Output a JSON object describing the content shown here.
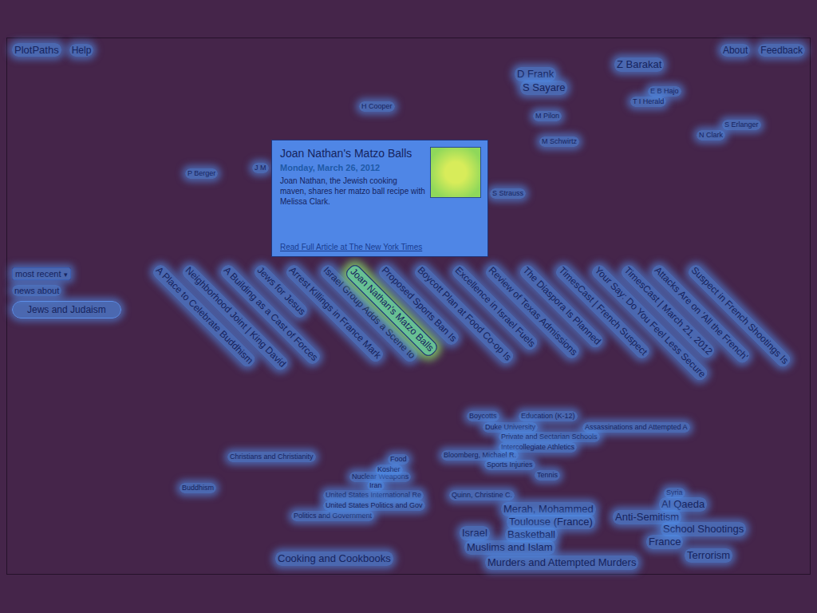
{
  "header": {
    "title": "PlotPaths",
    "links": [
      "Help",
      "About",
      "Feedback"
    ]
  },
  "sidebar": {
    "sort_select": "most recent",
    "label": "news about",
    "topic": "Jews and Judaism"
  },
  "authors": [
    {
      "name": "D Frank",
      "kind": "major"
    },
    {
      "name": "S Sayare",
      "kind": "major"
    },
    {
      "name": "Z Barakat",
      "kind": "major"
    },
    {
      "name": "E B Hajo",
      "kind": "minor"
    },
    {
      "name": "T I Herald",
      "kind": "minor"
    },
    {
      "name": "M Pilon",
      "kind": "minor"
    },
    {
      "name": "S Erlanger",
      "kind": "minor"
    },
    {
      "name": "N Clark",
      "kind": "minor"
    },
    {
      "name": "M Schwirtz",
      "kind": "minor"
    },
    {
      "name": "H Cooper",
      "kind": "minor"
    },
    {
      "name": "P Berger",
      "kind": "minor"
    },
    {
      "name": "J M",
      "kind": "minor"
    },
    {
      "name": "S Strauss",
      "kind": "minor"
    }
  ],
  "articles": [
    {
      "title": "A Place to Celebrate Buddhism",
      "selected": false
    },
    {
      "title": "Neighborhood Joint | King David",
      "selected": false
    },
    {
      "title": "A Building as a Cast of Forces",
      "selected": false
    },
    {
      "title": "Jews for Jesus",
      "selected": false
    },
    {
      "title": "Arrest Killings in France Mark",
      "selected": false
    },
    {
      "title": "Israel Group Adds a Scene to",
      "selected": false
    },
    {
      "title": "Joan Nathan's Matzo Balls",
      "selected": true
    },
    {
      "title": "Proposed Sports Ban Is",
      "selected": false
    },
    {
      "title": "Boycott Plan at Food Co-op Is",
      "selected": false
    },
    {
      "title": "Excellence in Israel Fuels",
      "selected": false
    },
    {
      "title": "Review of Texas Admissions",
      "selected": false
    },
    {
      "title": "The Diaspora Is Planned",
      "selected": false
    },
    {
      "title": "TimesCast | French Suspect",
      "selected": false
    },
    {
      "title": "Your Say: Do You Feel Less Secure",
      "selected": false
    },
    {
      "title": "TimesCast | March 21, 2012",
      "selected": false
    },
    {
      "title": "Attacks Are on 'All the French'",
      "selected": false
    },
    {
      "title": "Suspect in French Shootings Is",
      "selected": false
    }
  ],
  "tooltip": {
    "title": "Joan Nathan's Matzo Balls",
    "date": "Monday, March 26, 2012",
    "summary": "Joan Nathan, the Jewish cooking maven, shares her matzo ball recipe with Melissa Clark.",
    "link": "Read Full Article at The New York Times"
  },
  "topics": [
    {
      "label": "Christians and Christianity",
      "kind": "minor"
    },
    {
      "label": "Buddhism",
      "kind": "minor"
    },
    {
      "label": "Cooking and Cookbooks",
      "kind": "major"
    },
    {
      "label": "Politics and Government",
      "kind": "minor"
    },
    {
      "label": "United States International Re",
      "kind": "minor"
    },
    {
      "label": "United States Politics and Gov",
      "kind": "minor"
    },
    {
      "label": "Nuclear Weapons",
      "kind": "minor"
    },
    {
      "label": "Iran",
      "kind": "minor"
    },
    {
      "label": "Kosher",
      "kind": "minor"
    },
    {
      "label": "Food",
      "kind": "minor"
    },
    {
      "label": "Boycotts",
      "kind": "minor"
    },
    {
      "label": "Education (K-12)",
      "kind": "minor"
    },
    {
      "label": "Duke University",
      "kind": "minor"
    },
    {
      "label": "Private and Sectarian Schools",
      "kind": "minor"
    },
    {
      "label": "Intercollegiate Athletics",
      "kind": "minor"
    },
    {
      "label": "Bloomberg, Michael R.",
      "kind": "minor"
    },
    {
      "label": "Sports Injuries",
      "kind": "minor"
    },
    {
      "label": "Tennis",
      "kind": "minor"
    },
    {
      "label": "Quinn, Christine C.",
      "kind": "minor"
    },
    {
      "label": "Merah, Mohammed",
      "kind": "major"
    },
    {
      "label": "Toulouse (France)",
      "kind": "major"
    },
    {
      "label": "Israel",
      "kind": "major"
    },
    {
      "label": "Basketball",
      "kind": "major"
    },
    {
      "label": "Muslims and Islam",
      "kind": "major"
    },
    {
      "label": "Murders and Attempted Murders",
      "kind": "major"
    },
    {
      "label": "Assassinations and Attempted A",
      "kind": "minor"
    },
    {
      "label": "Syria",
      "kind": "minor"
    },
    {
      "label": "Al Qaeda",
      "kind": "major"
    },
    {
      "label": "Anti-Semitism",
      "kind": "major"
    },
    {
      "label": "School Shootings",
      "kind": "major"
    },
    {
      "label": "France",
      "kind": "major"
    },
    {
      "label": "Terrorism",
      "kind": "major"
    }
  ]
}
